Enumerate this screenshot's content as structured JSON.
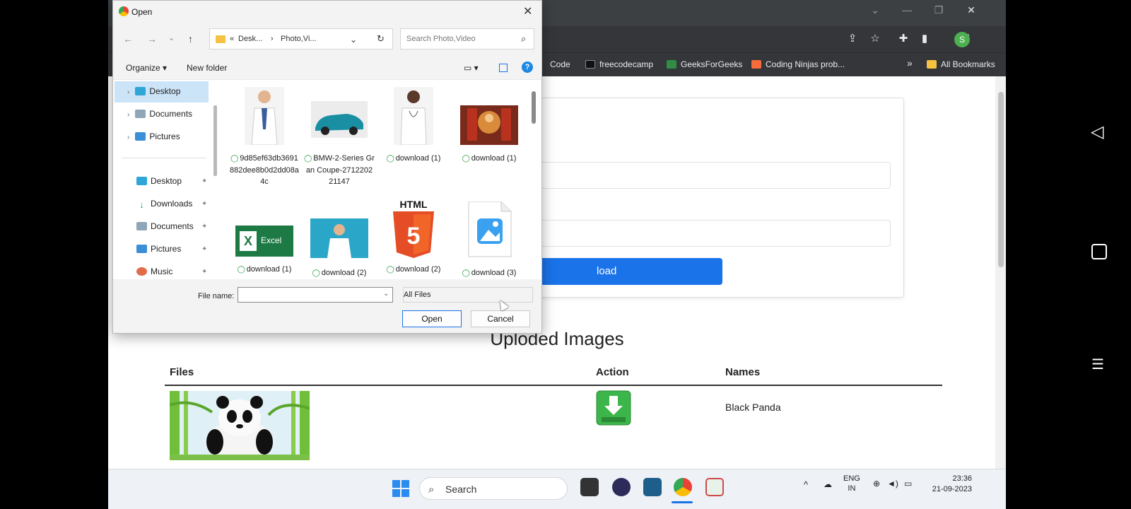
{
  "browser": {
    "bookmarks": [
      {
        "label": "Code",
        "color": "#5f6368"
      },
      {
        "label": "freecodecamp",
        "color": "#000000"
      },
      {
        "label": "GeeksForGeeks",
        "color": "#2f8d46"
      },
      {
        "label": "Coding Ninjas prob...",
        "color": "#f66c3b"
      }
    ],
    "more_bookmarks": "»",
    "all_bookmarks": "All Bookmarks",
    "profile_initial": "S"
  },
  "page": {
    "upload_button": "load",
    "uploaded_title": "Uploded Images",
    "table": {
      "headers": [
        "Files",
        "Action",
        "Names"
      ],
      "rows": [
        {
          "file": "panda-image",
          "action": "download",
          "name": "Black Panda"
        }
      ]
    }
  },
  "dialog": {
    "title": "Open",
    "path": {
      "prefix": "«",
      "part1": "Desk...",
      "sep": "›",
      "part2": "Photo,Vi..."
    },
    "search_placeholder": "Search Photo,Video",
    "organize": "Organize",
    "new_folder": "New folder",
    "help": "?",
    "nav": {
      "tree": [
        "Desktop",
        "Documents",
        "Pictures"
      ],
      "quick_access": [
        "Desktop",
        "Downloads",
        "Documents",
        "Pictures",
        "Music"
      ]
    },
    "files": [
      {
        "name": "9d85ef63db3691882dee8b0d2dd08a4c",
        "kind": "doctor-male"
      },
      {
        "name": "BMW-2-Series Gran Coupe-271220221147",
        "kind": "car"
      },
      {
        "name": "download (1)",
        "kind": "doctor-female"
      },
      {
        "name": "download (1)",
        "kind": "painting"
      },
      {
        "name": "download (1)",
        "kind": "excel"
      },
      {
        "name": "download (2)",
        "kind": "doctor-blue"
      },
      {
        "name": "download (2)",
        "kind": "html5"
      },
      {
        "name": "download (3)",
        "kind": "image-file"
      }
    ],
    "excel_label": "Excel",
    "html_label": "HTML",
    "file_name_label": "File name:",
    "file_name_value": "",
    "file_type": "All Files",
    "open_button": "Open",
    "cancel_button": "Cancel"
  },
  "taskbar": {
    "search": "Search",
    "lang_top": "ENG",
    "lang_bottom": "IN",
    "time": "23:36",
    "date": "21-09-2023"
  }
}
